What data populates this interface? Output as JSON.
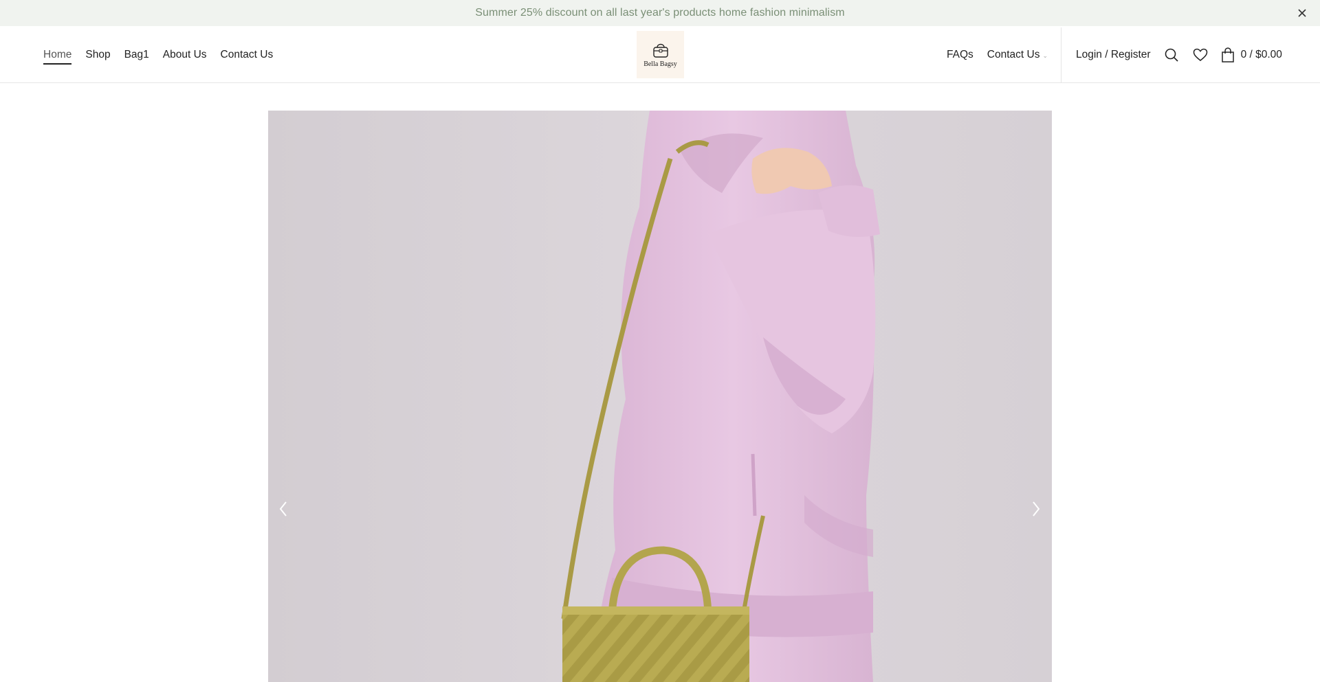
{
  "announcement": {
    "text": "Summer 25% discount on all last year's products home fashion minimalism",
    "close_icon": "close-icon"
  },
  "nav_left": [
    {
      "label": "Home",
      "active": true
    },
    {
      "label": "Shop"
    },
    {
      "label": "Bag1"
    },
    {
      "label": "About Us"
    },
    {
      "label": "Contact Us"
    }
  ],
  "logo": {
    "text": "Bella Bagsy",
    "icon": "handbag-icon"
  },
  "nav_right": [
    {
      "label": "FAQs"
    },
    {
      "label": "Contact Us",
      "has_dropdown": true
    }
  ],
  "account": {
    "login_label": "Login / Register",
    "search_icon": "search-icon",
    "wishlist_icon": "heart-icon",
    "cart_icon": "shopping-bag-icon",
    "cart_summary": "0 / $0.00"
  },
  "hero": {
    "prev_icon": "chevron-left-icon",
    "next_icon": "chevron-right-icon"
  },
  "colors": {
    "announcement_bg": "#f0f3ef",
    "announcement_text": "#7a8f76",
    "hero_bg": "#d8d2d7",
    "hoodie": "#e2bfdc",
    "bag": "#bdb057"
  }
}
